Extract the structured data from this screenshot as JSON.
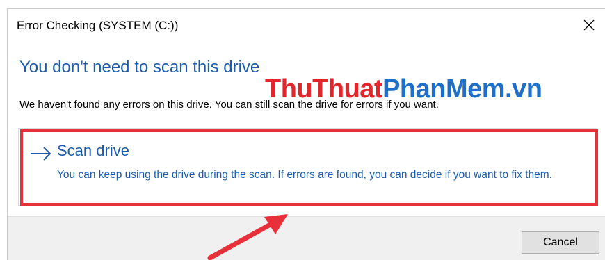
{
  "window": {
    "title": "Error Checking (SYSTEM (C:))"
  },
  "main": {
    "heading": "You don't need to scan this drive",
    "description": "We haven't found any errors on this drive. You can still scan the drive for errors if you want."
  },
  "scan_option": {
    "icon": "right-arrow-icon",
    "title": "Scan drive",
    "description": "You can keep using the drive during the scan. If errors are found, you can decide if you want to fix them."
  },
  "footer": {
    "cancel_label": "Cancel"
  },
  "watermark": {
    "part1": "ThuThuat",
    "part2": "PhanMem",
    "part3": ".vn"
  },
  "colors": {
    "accent_blue": "#1a5db0",
    "highlight_red": "#e8303a",
    "watermark_red": "#e3262b",
    "watermark_blue": "#1e6fc9"
  }
}
